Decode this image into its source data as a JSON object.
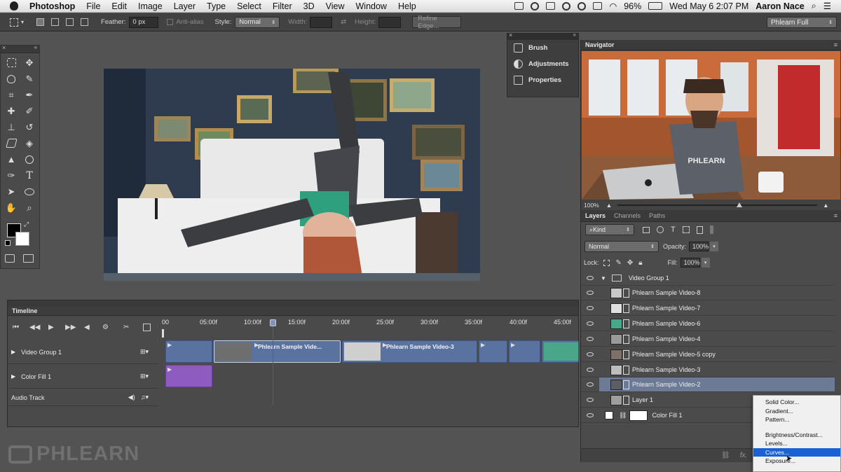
{
  "menubar": {
    "app_name": "Photoshop",
    "menus": [
      "File",
      "Edit",
      "Image",
      "Layer",
      "Type",
      "Select",
      "Filter",
      "3D",
      "View",
      "Window",
      "Help"
    ],
    "battery": "96%",
    "clock": "Wed May 6  2:07 PM",
    "user": "Aaron Nace"
  },
  "options_bar": {
    "feather_label": "Feather:",
    "feather_value": "0 px",
    "antialias_label": "Anti-alias",
    "style_label": "Style:",
    "style_value": "Normal",
    "width_label": "Width:",
    "height_label": "Height:",
    "refine_edge_label": "Refine Edge...",
    "workspace_value": "Phlearn Full"
  },
  "mini_panel": {
    "items": [
      "Brush",
      "Adjustments",
      "Properties"
    ]
  },
  "navigator": {
    "tab_label": "Navigator",
    "zoom": "100%",
    "shirt_text": "PHLEARN"
  },
  "layers_panel": {
    "tabs": [
      "Layers",
      "Channels",
      "Paths"
    ],
    "filter_value": "Kind",
    "blend_mode": "Normal",
    "opacity_label": "Opacity:",
    "opacity_value": "100%",
    "lock_label": "Lock:",
    "fill_label": "Fill:",
    "fill_value": "100%",
    "group_name": "Video Group 1",
    "layers": [
      "Phlearn Sample Video-8",
      "Phlearn Sample Video-7",
      "Phlearn Sample Video-6",
      "Phlearn Sample Video-4",
      "Phlearn Sample Video-5 copy",
      "Phlearn Sample Video-3",
      "Phlearn Sample Video-2",
      "Layer 1"
    ],
    "selected_layer": "Phlearn Sample Video-2",
    "color_fill_name": "Color Fill 1"
  },
  "context_menu": {
    "group1": [
      "Solid Color...",
      "Gradient...",
      "Pattern..."
    ],
    "group2": [
      "Brightness/Contrast...",
      "Levels...",
      "Curves...",
      "Exposure..."
    ],
    "highlighted": "Curves..."
  },
  "timeline": {
    "tab_label": "Timeline",
    "ruler": [
      "00",
      "05:00f",
      "10:00f",
      "15:00f",
      "20:00f",
      "25:00f",
      "30:00f",
      "35:00f",
      "40:00f",
      "45:00f"
    ],
    "tracks": [
      "Video Group 1",
      "Color Fill 1",
      "Audio Track"
    ],
    "clip_labels": [
      "Phlearn Sample Vide...",
      "Phlearn Sample Video-3"
    ],
    "colors": {
      "video_clip": "#5a72a0",
      "color_fill_clip": "#8e5cc0",
      "playhead": "#c0392b"
    }
  },
  "watermark": "PHLEARN"
}
